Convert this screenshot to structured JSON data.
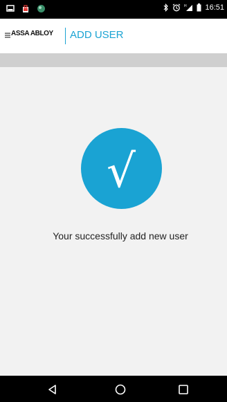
{
  "status_bar": {
    "time": "16:51",
    "left_icons": [
      "screenshot-icon",
      "shopping-bag-icon",
      "globe-icon"
    ],
    "right_icons": [
      "bluetooth-icon",
      "alarm-icon",
      "signal-icon",
      "battery-icon"
    ]
  },
  "app_bar": {
    "brand": "ASSA ABLOY",
    "title": "ADD USER",
    "accent_color": "#1aa3d3"
  },
  "main": {
    "check_symbol": "√",
    "message": "Your successfully add new user"
  },
  "nav_bar": {
    "buttons": [
      "back-icon",
      "home-icon",
      "recents-icon"
    ]
  }
}
